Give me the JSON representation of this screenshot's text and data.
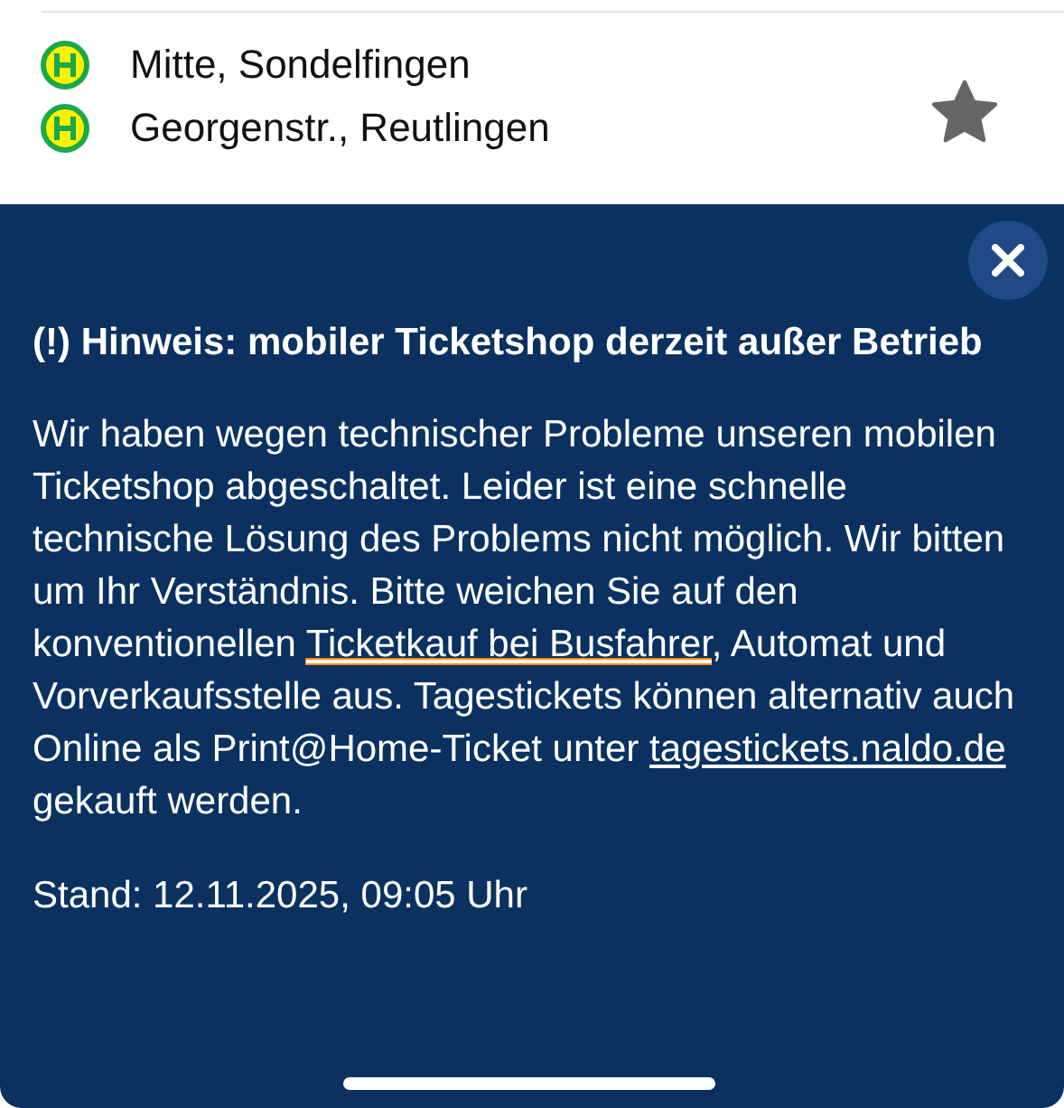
{
  "stops": [
    {
      "name": "Mitte, Sondelfingen"
    },
    {
      "name": "Georgenstr., Reutlingen"
    }
  ],
  "favorite": {
    "on": true
  },
  "notice": {
    "title": "(!) Hinweis: mobiler Ticketshop derzeit außer Betrieb",
    "body": [
      {
        "kind": "text",
        "text": "Wir haben wegen technischer Probleme unseren mobilen Ticketshop abgeschaltet. Leider ist eine schnelle technische Lösung des Problems nicht möglich. Wir bitten um Ihr Verständnis. Bitte weichen Sie auf den konventionellen "
      },
      {
        "kind": "link",
        "text": "Ticketkauf bei Busfahrer",
        "highlighted": true
      },
      {
        "kind": "text",
        "text": ", Automat und Vorverkaufsstelle aus. Tagestickets können alternativ auch Online als Print@Home-Ticket unter "
      },
      {
        "kind": "link",
        "text": "tagestickets.naldo.de",
        "highlighted": false
      },
      {
        "kind": "text",
        "text": " gekauft werden."
      }
    ],
    "stand": "Stand: 12.11.2025, 09:05 Uhr"
  }
}
